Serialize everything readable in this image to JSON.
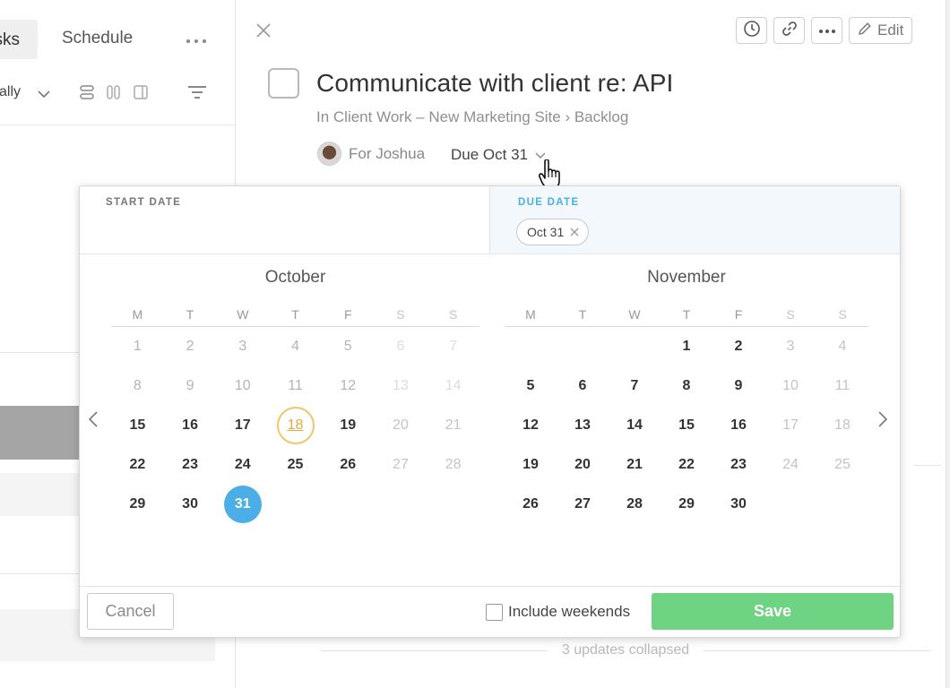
{
  "left_pane": {
    "tabs": [
      {
        "label": "Tasks",
        "active": true
      },
      {
        "label": "Schedule",
        "active": false
      }
    ],
    "more_icon": "more-horizontal-icon",
    "sort_label": "Manually"
  },
  "detail": {
    "toolbar": {
      "edit_label": "Edit"
    },
    "title": "Communicate with client re: API",
    "breadcrumb": "In Client Work – New Marketing Site › Backlog",
    "assignee_label": "For Joshua",
    "due_label": "Due Oct 31",
    "updates_label": "3 updates collapsed"
  },
  "datepicker": {
    "start_label": "START DATE",
    "due_label": "DUE DATE",
    "due_chip": "Oct 31",
    "weekday_headers": [
      "M",
      "T",
      "W",
      "T",
      "F",
      "S",
      "S"
    ],
    "months": [
      {
        "name": "October",
        "weeks": [
          [
            {
              "d": "1",
              "s": "past"
            },
            {
              "d": "2",
              "s": "past"
            },
            {
              "d": "3",
              "s": "past"
            },
            {
              "d": "4",
              "s": "past"
            },
            {
              "d": "5",
              "s": "past"
            },
            {
              "d": "6",
              "s": "pastwe"
            },
            {
              "d": "7",
              "s": "pastwe"
            }
          ],
          [
            {
              "d": "8",
              "s": "past"
            },
            {
              "d": "9",
              "s": "past"
            },
            {
              "d": "10",
              "s": "past"
            },
            {
              "d": "11",
              "s": "past"
            },
            {
              "d": "12",
              "s": "past"
            },
            {
              "d": "13",
              "s": "pastwe"
            },
            {
              "d": "14",
              "s": "pastwe"
            }
          ],
          [
            {
              "d": "15",
              "s": "cur"
            },
            {
              "d": "16",
              "s": "cur"
            },
            {
              "d": "17",
              "s": "cur"
            },
            {
              "d": "18",
              "s": "today"
            },
            {
              "d": "19",
              "s": "cur"
            },
            {
              "d": "20",
              "s": "we"
            },
            {
              "d": "21",
              "s": "we"
            }
          ],
          [
            {
              "d": "22",
              "s": "cur"
            },
            {
              "d": "23",
              "s": "cur"
            },
            {
              "d": "24",
              "s": "cur"
            },
            {
              "d": "25",
              "s": "cur"
            },
            {
              "d": "26",
              "s": "cur"
            },
            {
              "d": "27",
              "s": "we"
            },
            {
              "d": "28",
              "s": "we"
            }
          ],
          [
            {
              "d": "29",
              "s": "cur"
            },
            {
              "d": "30",
              "s": "cur"
            },
            {
              "d": "31",
              "s": "selected"
            },
            {
              "d": "",
              "s": "empty"
            },
            {
              "d": "",
              "s": "empty"
            },
            {
              "d": "",
              "s": "empty"
            },
            {
              "d": "",
              "s": "empty"
            }
          ]
        ]
      },
      {
        "name": "November",
        "weeks": [
          [
            {
              "d": "",
              "s": "empty"
            },
            {
              "d": "",
              "s": "empty"
            },
            {
              "d": "",
              "s": "empty"
            },
            {
              "d": "1",
              "s": "cur"
            },
            {
              "d": "2",
              "s": "cur"
            },
            {
              "d": "3",
              "s": "we"
            },
            {
              "d": "4",
              "s": "we"
            }
          ],
          [
            {
              "d": "5",
              "s": "cur"
            },
            {
              "d": "6",
              "s": "cur"
            },
            {
              "d": "7",
              "s": "cur"
            },
            {
              "d": "8",
              "s": "cur"
            },
            {
              "d": "9",
              "s": "cur"
            },
            {
              "d": "10",
              "s": "we"
            },
            {
              "d": "11",
              "s": "we"
            }
          ],
          [
            {
              "d": "12",
              "s": "cur"
            },
            {
              "d": "13",
              "s": "cur"
            },
            {
              "d": "14",
              "s": "cur"
            },
            {
              "d": "15",
              "s": "cur"
            },
            {
              "d": "16",
              "s": "cur"
            },
            {
              "d": "17",
              "s": "we"
            },
            {
              "d": "18",
              "s": "we"
            }
          ],
          [
            {
              "d": "19",
              "s": "cur"
            },
            {
              "d": "20",
              "s": "cur"
            },
            {
              "d": "21",
              "s": "cur"
            },
            {
              "d": "22",
              "s": "cur"
            },
            {
              "d": "23",
              "s": "cur"
            },
            {
              "d": "24",
              "s": "we"
            },
            {
              "d": "25",
              "s": "we"
            }
          ],
          [
            {
              "d": "26",
              "s": "cur"
            },
            {
              "d": "27",
              "s": "cur"
            },
            {
              "d": "28",
              "s": "cur"
            },
            {
              "d": "29",
              "s": "cur"
            },
            {
              "d": "30",
              "s": "cur"
            },
            {
              "d": "",
              "s": "empty"
            },
            {
              "d": "",
              "s": "empty"
            }
          ]
        ]
      }
    ],
    "cancel_label": "Cancel",
    "include_weekends_label": "Include weekends",
    "include_weekends_checked": false,
    "save_label": "Save"
  },
  "colors": {
    "accent_blue": "#4baee6",
    "save_green": "#6ed382",
    "today_orange": "#e8a83b"
  }
}
